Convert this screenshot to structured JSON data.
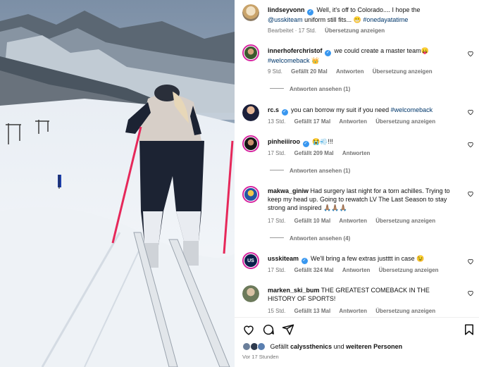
{
  "post": {
    "username": "lindseyvonn",
    "caption_before": " Well, it's off to Colorado.... I hope the ",
    "mention": "@usskiteam",
    "caption_after": " uniform still fits... 😬 ",
    "hashtag": "#onedayatatime",
    "edited": "Bearbeitet · 17 Std.",
    "translate": "Übersetzung anzeigen"
  },
  "comments": [
    {
      "username": "innerhoferchristof",
      "verified": true,
      "text": " we could create a master team😛 ",
      "tag": "#welcomeback",
      "tail": " 👑",
      "time": "9 Std.",
      "likes": "Gefällt 20 Mal",
      "reply": "Antworten",
      "translate": "Übersetzung anzeigen",
      "view_replies": "Antworten ansehen (1)"
    },
    {
      "username": "rc.s",
      "verified": true,
      "text": " you can borrow my suit if you need ",
      "tag": "#welcomeback",
      "tail": "",
      "time": "13 Std.",
      "likes": "Gefällt 17 Mal",
      "reply": "Antworten",
      "translate": "Übersetzung anzeigen"
    },
    {
      "username": "pinheiiiroo",
      "verified": true,
      "text": " 😭💨!!!",
      "tag": "",
      "tail": "",
      "time": "17 Std.",
      "likes": "Gefällt 209 Mal",
      "reply": "Antworten",
      "view_replies": "Antworten ansehen (1)"
    },
    {
      "username": "makwa_giniw",
      "verified": false,
      "text": " Had surgery last night for a torn achilles. Trying to keep my head up. Going to rewatch LV The Last Season to stay strong and inspired 🙏🏽🙏🏽🙏🏽",
      "tag": "",
      "tail": "",
      "time": "17 Std.",
      "likes": "Gefällt 10 Mal",
      "reply": "Antworten",
      "translate": "Übersetzung anzeigen",
      "view_replies": "Antworten ansehen (4)"
    },
    {
      "username": "usskiteam",
      "verified": true,
      "text": " We'll bring a few extras justttt in case 😉",
      "tag": "",
      "tail": "",
      "time": "17 Std.",
      "likes": "Gefällt 324 Mal",
      "reply": "Antworten",
      "translate": "Übersetzung anzeigen"
    },
    {
      "username": "marken_ski_bum",
      "verified": false,
      "text": " THE GREATEST COMEBACK IN THE HISTORY OF SPORTS!",
      "tag": "",
      "tail": "",
      "time": "15 Std.",
      "likes": "Gefällt 13 Mal",
      "reply": "Antworten",
      "translate": "Übersetzung anzeigen"
    }
  ],
  "footer": {
    "liked_prefix": "Gefällt ",
    "liked_user": "calyssthenics",
    "liked_mid": " und ",
    "liked_others": "weiteren Personen",
    "timestamp": "Vor 17 Stunden"
  },
  "icons": [
    "heart-icon",
    "comment-icon",
    "share-icon",
    "bookmark-icon",
    "verified-icon"
  ],
  "colors": {
    "link": "#00376b",
    "muted": "#737373",
    "verified": "#3897f0",
    "story_ring": "#d6249f"
  }
}
